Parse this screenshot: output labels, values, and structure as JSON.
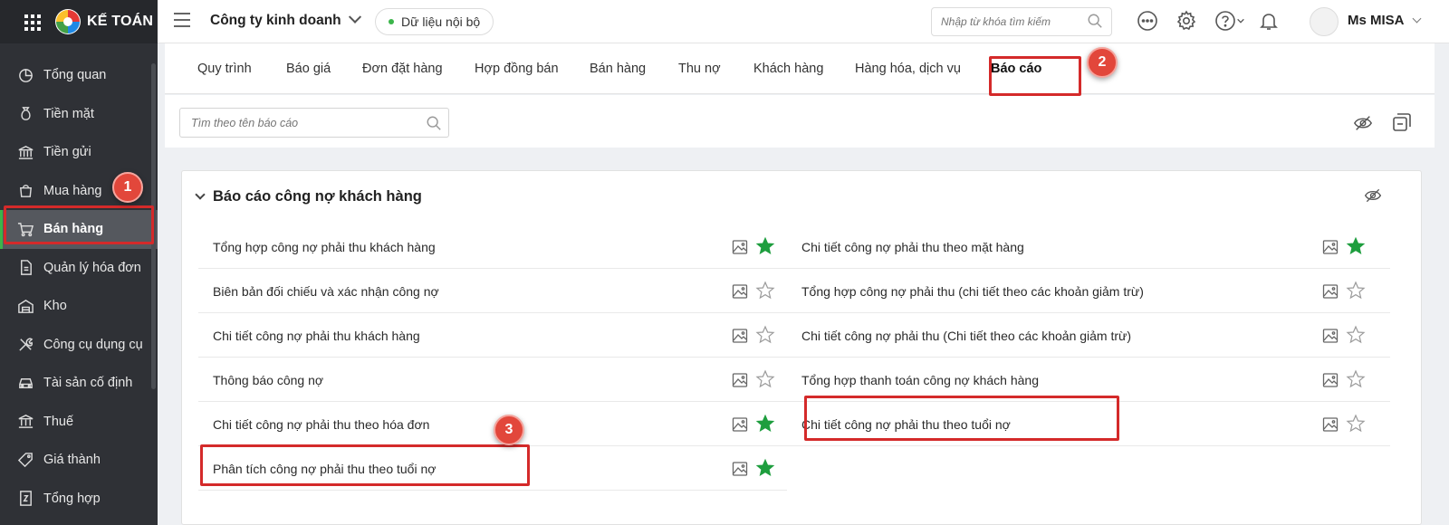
{
  "brand": {
    "name": "KẾ TOÁN"
  },
  "topbar": {
    "company": "Công ty kinh doanh",
    "data_scope": "Dữ liệu nội bộ",
    "search_placeholder": "Nhập từ khóa tìm kiếm",
    "user": "Ms MISA"
  },
  "sidebar": {
    "items": [
      {
        "label": "Tổng quan",
        "icon": "dashboard-icon"
      },
      {
        "label": "Tiền mặt",
        "icon": "money-bag-icon"
      },
      {
        "label": "Tiền gửi",
        "icon": "bank-icon"
      },
      {
        "label": "Mua hàng",
        "icon": "shopping-bag-icon"
      },
      {
        "label": "Bán hàng",
        "icon": "cart-icon"
      },
      {
        "label": "Quản lý hóa đơn",
        "icon": "invoice-icon"
      },
      {
        "label": "Kho",
        "icon": "warehouse-icon"
      },
      {
        "label": "Công cụ dụng cụ",
        "icon": "tools-icon"
      },
      {
        "label": "Tài sản cố định",
        "icon": "car-icon"
      },
      {
        "label": "Thuế",
        "icon": "tax-icon"
      },
      {
        "label": "Giá thành",
        "icon": "price-tag-icon"
      },
      {
        "label": "Tổng hợp",
        "icon": "summary-icon"
      }
    ],
    "active_label": "Bán hàng"
  },
  "tabs": [
    "Quy trình",
    "Báo giá",
    "Đơn đặt hàng",
    "Hợp đồng bán",
    "Bán hàng",
    "Thu nợ",
    "Khách hàng",
    "Hàng hóa, dịch vụ",
    "Báo cáo"
  ],
  "active_tab": "Báo cáo",
  "report_search": {
    "placeholder": "Tìm theo tên báo cáo"
  },
  "section": {
    "title": "Báo cáo công nợ khách hàng",
    "left": [
      {
        "label": "Tổng hợp công nợ phải thu khách hàng",
        "favorite": true
      },
      {
        "label": "Biên bản đối chiếu và xác nhận công nợ",
        "favorite": false
      },
      {
        "label": "Chi tiết công nợ phải thu khách hàng",
        "favorite": false
      },
      {
        "label": "Thông báo công nợ",
        "favorite": false
      },
      {
        "label": "Chi tiết công nợ phải thu theo hóa đơn",
        "favorite": true
      },
      {
        "label": "Phân tích công nợ phải thu theo tuổi nợ",
        "favorite": true
      }
    ],
    "right": [
      {
        "label": "Chi tiết công nợ phải thu theo mặt hàng",
        "favorite": true
      },
      {
        "label": "Tổng hợp công nợ phải thu (chi tiết theo các khoản giảm trừ)",
        "favorite": false
      },
      {
        "label": "Chi tiết công nợ phải thu (Chi tiết theo các khoản giảm trừ)",
        "favorite": false
      },
      {
        "label": "Tổng hợp thanh toán công nợ khách hàng",
        "favorite": false
      },
      {
        "label": "Chi tiết công nợ phải thu theo tuổi nợ",
        "favorite": false
      }
    ]
  },
  "callouts": [
    "1",
    "2",
    "3"
  ],
  "colors": {
    "sidebar": "#2f3136",
    "accent_green": "#1e9e3e",
    "highlight_red": "#d42a2a",
    "badge_red": "#e2473b"
  }
}
